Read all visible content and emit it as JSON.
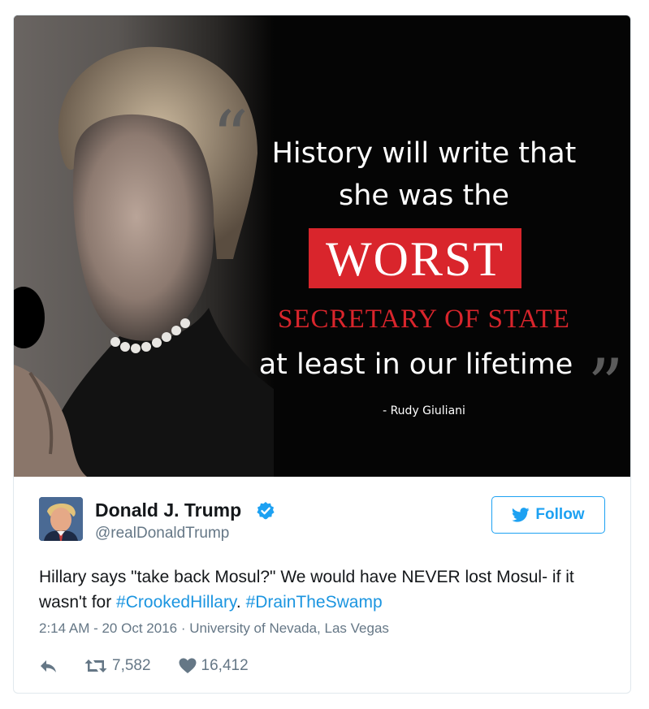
{
  "media": {
    "quote_lines": [
      "History will write that",
      "she was the"
    ],
    "worst": "WORST",
    "secretary": "SECRETARY OF STATE",
    "last_line": "at least in our lifetime",
    "attribution": "- Rudy Giuliani",
    "colors": {
      "accent_red": "#d9252c",
      "background": "#050505"
    }
  },
  "author": {
    "name": "Donald J. Trump",
    "handle": "@realDonaldTrump",
    "verified_icon": "verified-badge-icon"
  },
  "follow": {
    "label": "Follow",
    "icon": "twitter-bird-icon"
  },
  "tweet": {
    "text_part1": "Hillary says \"take back Mosul?\" We would have NEVER lost Mosul- if it wasn't for ",
    "hashtag1": "#CrookedHillary",
    "separator": ". ",
    "hashtag2": "#DrainTheSwamp",
    "meta": "2:14 AM - 20 Oct 2016 · University of Nevada, Las Vegas"
  },
  "stats": {
    "retweets": "7,582",
    "likes": "16,412"
  },
  "colors": {
    "link": "#1b95e0",
    "follow_blue": "#1da1f2",
    "muted": "#657786"
  }
}
